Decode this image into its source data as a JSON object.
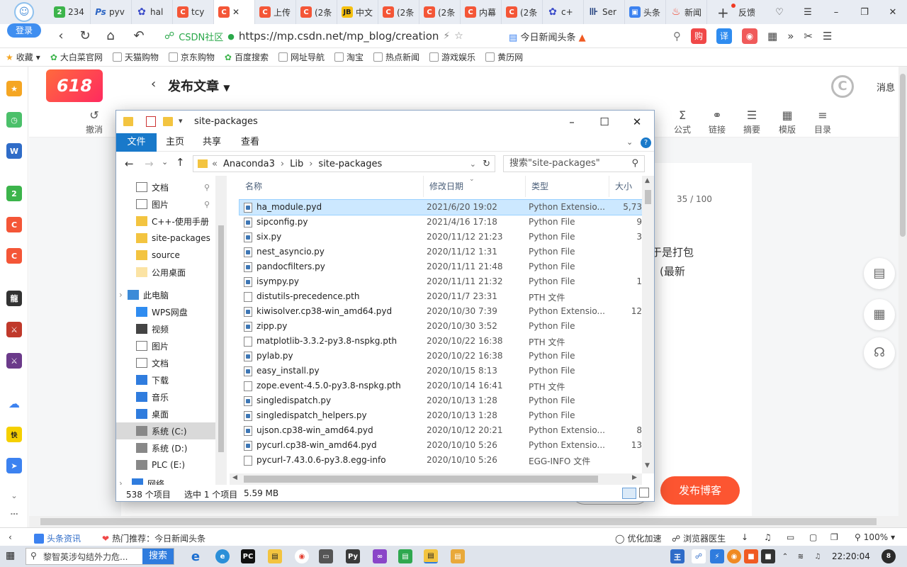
{
  "browser": {
    "login_label": "登录",
    "tabs": [
      {
        "label": "234",
        "icon": "g"
      },
      {
        "label": "pyv",
        "icon": "ps"
      },
      {
        "label": "hal",
        "icon": "p"
      },
      {
        "label": "tcy",
        "icon": "c"
      },
      {
        "label": "✕",
        "icon": "c",
        "active": true
      },
      {
        "label": "上传",
        "icon": "c"
      },
      {
        "label": "(2条",
        "icon": "c"
      },
      {
        "label": "中文",
        "icon": "j"
      },
      {
        "label": "(2条",
        "icon": "c"
      },
      {
        "label": "(2条",
        "icon": "c"
      },
      {
        "label": "内幕",
        "icon": "c"
      },
      {
        "label": "(2条",
        "icon": "c"
      },
      {
        "label": "c+",
        "icon": "p"
      },
      {
        "label": "Ser",
        "icon": "s"
      },
      {
        "label": "头条",
        "icon": "t"
      },
      {
        "label": "新闻",
        "icon": "f"
      }
    ],
    "new_tab": "+",
    "feedback": "反馈",
    "site_tag": "CSDN社区",
    "url": "https://mp.csdn.net/mp_blog/creation",
    "hot_news": "今日新闻头条",
    "bookmarks": [
      "收藏",
      "大白菜官网",
      "天猫购物",
      "京东购物",
      "百度搜索",
      "网址导航",
      "淘宝",
      "热点新闻",
      "游戏娱乐",
      "黄历网"
    ],
    "nav_right_icons": [
      "购",
      "译"
    ]
  },
  "editor": {
    "badge": "618",
    "title": "发布文章",
    "message": "消息",
    "toolbar": [
      {
        "icon": "↺",
        "label": "撤消"
      },
      {
        "icon": "Σ",
        "label": "公式"
      },
      {
        "icon": "⚭",
        "label": "链接"
      },
      {
        "icon": "☰",
        "label": "摘要"
      },
      {
        "icon": "▦",
        "label": "模版"
      },
      {
        "icon": "≡",
        "label": "目录"
      }
    ],
    "counter": "35 / 100",
    "snippet1": "于是打包",
    "snippet2": "(最新",
    "publish": "发布博客"
  },
  "status": {
    "news": "头条资讯",
    "hot": "热门推荐：今日新闻头条",
    "optimize": "优化加速",
    "doctor": "浏览器医生",
    "zoom": "100%"
  },
  "taskbar": {
    "search_placeholder": "黎智英涉勾结外力危...",
    "search_button": "搜索",
    "time": "22:20:04",
    "notify": "8"
  },
  "explorer": {
    "title": "site-packages",
    "ribbon": [
      "文件",
      "主页",
      "共享",
      "查看"
    ],
    "path": [
      "Anaconda3",
      "Lib",
      "site-packages"
    ],
    "search_placeholder": "搜索\"site-packages\"",
    "nav": [
      {
        "label": "文档",
        "pin": true
      },
      {
        "label": "图片",
        "pin": true
      },
      {
        "label": "C++-使用手册"
      },
      {
        "label": "site-packages"
      },
      {
        "label": "source"
      },
      {
        "label": "公用桌面"
      },
      {
        "label": "此电脑"
      },
      {
        "label": "WPS网盘"
      },
      {
        "label": "视频"
      },
      {
        "label": "图片"
      },
      {
        "label": "文档"
      },
      {
        "label": "下载"
      },
      {
        "label": "音乐"
      },
      {
        "label": "桌面"
      },
      {
        "label": "系统 (C:)",
        "selected": true
      },
      {
        "label": "系统 (D:)"
      },
      {
        "label": "PLC (E:)"
      },
      {
        "label": "网络"
      }
    ],
    "columns": [
      "名称",
      "修改日期",
      "类型",
      "大小"
    ],
    "files": [
      {
        "name": "ha_module.pyd",
        "date": "2021/6/20 19:02",
        "type": "Python Extensio...",
        "size": "5,73",
        "selected": true,
        "kind": "py"
      },
      {
        "name": "sipconfig.py",
        "date": "2021/4/16 17:18",
        "type": "Python File",
        "size": "9",
        "kind": "py"
      },
      {
        "name": "six.py",
        "date": "2020/11/12 21:23",
        "type": "Python File",
        "size": "3",
        "kind": "py"
      },
      {
        "name": "nest_asyncio.py",
        "date": "2020/11/12 1:31",
        "type": "Python File",
        "size": "",
        "kind": "py"
      },
      {
        "name": "pandocfilters.py",
        "date": "2020/11/11 21:48",
        "type": "Python File",
        "size": "",
        "kind": "py"
      },
      {
        "name": "isympy.py",
        "date": "2020/11/11 21:32",
        "type": "Python File",
        "size": "1",
        "kind": "py"
      },
      {
        "name": "distutils-precedence.pth",
        "date": "2020/11/7 23:31",
        "type": "PTH 文件",
        "size": "",
        "kind": "doc"
      },
      {
        "name": "kiwisolver.cp38-win_amd64.pyd",
        "date": "2020/10/30 7:39",
        "type": "Python Extensio...",
        "size": "12",
        "kind": "py"
      },
      {
        "name": "zipp.py",
        "date": "2020/10/30 3:52",
        "type": "Python File",
        "size": "",
        "kind": "py"
      },
      {
        "name": "matplotlib-3.3.2-py3.8-nspkg.pth",
        "date": "2020/10/22 16:38",
        "type": "PTH 文件",
        "size": "",
        "kind": "doc"
      },
      {
        "name": "pylab.py",
        "date": "2020/10/22 16:38",
        "type": "Python File",
        "size": "",
        "kind": "py"
      },
      {
        "name": "easy_install.py",
        "date": "2020/10/15 8:13",
        "type": "Python File",
        "size": "",
        "kind": "py"
      },
      {
        "name": "zope.event-4.5.0-py3.8-nspkg.pth",
        "date": "2020/10/14 16:41",
        "type": "PTH 文件",
        "size": "",
        "kind": "doc"
      },
      {
        "name": "singledispatch.py",
        "date": "2020/10/13 1:28",
        "type": "Python File",
        "size": "",
        "kind": "py"
      },
      {
        "name": "singledispatch_helpers.py",
        "date": "2020/10/13 1:28",
        "type": "Python File",
        "size": "",
        "kind": "py"
      },
      {
        "name": "ujson.cp38-win_amd64.pyd",
        "date": "2020/10/12 20:21",
        "type": "Python Extensio...",
        "size": "8",
        "kind": "py"
      },
      {
        "name": "pycurl.cp38-win_amd64.pyd",
        "date": "2020/10/10 5:26",
        "type": "Python Extensio...",
        "size": "13",
        "kind": "py"
      },
      {
        "name": "pycurl-7.43.0.6-py3.8.egg-info",
        "date": "2020/10/10 5:26",
        "type": "EGG-INFO 文件",
        "size": "",
        "kind": "doc"
      }
    ],
    "status_count": "538 个项目",
    "status_selected": "选中 1 个项目",
    "status_size": "5.59 MB"
  }
}
